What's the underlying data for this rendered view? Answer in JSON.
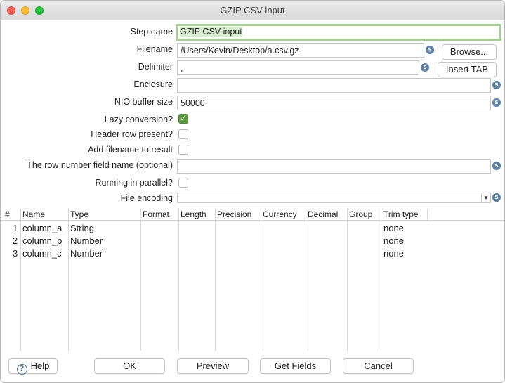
{
  "window": {
    "title": "GZIP CSV input"
  },
  "form": {
    "step_name": {
      "label": "Step name",
      "value": "GZIP CSV input"
    },
    "filename": {
      "label": "Filename",
      "value": "/Users/Kevin/Desktop/a.csv.gz",
      "button": "Browse..."
    },
    "delimiter": {
      "label": "Delimiter",
      "value": ",",
      "button": "Insert TAB"
    },
    "enclosure": {
      "label": "Enclosure",
      "value": ""
    },
    "nio_buffer": {
      "label": "NIO buffer size",
      "value": "50000"
    },
    "lazy_conversion": {
      "label": "Lazy conversion?",
      "checked": true
    },
    "header_row": {
      "label": "Header row present?",
      "checked": false
    },
    "add_filename": {
      "label": "Add filename to result",
      "checked": false
    },
    "row_number_field": {
      "label": "The row number field name (optional)",
      "value": ""
    },
    "running_parallel": {
      "label": "Running in parallel?",
      "checked": false
    },
    "file_encoding": {
      "label": "File encoding",
      "value": ""
    }
  },
  "grid": {
    "headers": [
      "#",
      "Name",
      "Type",
      "Format",
      "Length",
      "Precision",
      "Currency",
      "Decimal",
      "Group",
      "Trim type"
    ],
    "rows": [
      [
        "1",
        "column_a",
        "String",
        "",
        "",
        "",
        "",
        "",
        "",
        "none"
      ],
      [
        "2",
        "column_b",
        "Number",
        "",
        "",
        "",
        "",
        "",
        "",
        "none"
      ],
      [
        "3",
        "column_c",
        "Number",
        "",
        "",
        "",
        "",
        "",
        "",
        "none"
      ]
    ]
  },
  "buttons": {
    "help": "Help",
    "ok": "OK",
    "preview": "Preview",
    "get_fields": "Get Fields",
    "cancel": "Cancel"
  },
  "icons": {
    "variable": "variable-dollar-icon",
    "help": "help-question-icon",
    "check": "checkmark-icon"
  },
  "colors": {
    "focus_border": "#a4cf93",
    "checkbox_checked": "#5b9a42",
    "variable_icon": "#5a7fa8"
  }
}
